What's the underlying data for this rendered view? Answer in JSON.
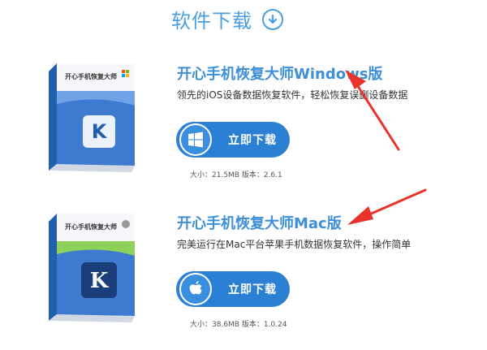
{
  "header": {
    "title": "软件下载",
    "icon": "download-circle-icon"
  },
  "products": [
    {
      "title": "开心手机恢复大师Windows版",
      "description": "领先的iOS设备数据恢复软件，轻松恢复误删设备数据",
      "button_label": "立即下载",
      "os_icon": "windows-icon",
      "box_label": "开心手机恢复大师",
      "meta": "大小：21.5MB 版本：2.6.1"
    },
    {
      "title": "开心手机恢复大师Mac版",
      "description": "完美运行在Mac平台苹果手机数据恢复软件，操作简单",
      "button_label": "立即下载",
      "os_icon": "apple-icon",
      "box_label": "开心手机恢复大师",
      "meta": "大小：38.6MB 版本：1.0.24"
    }
  ],
  "colors": {
    "accent": "#4a9fe1",
    "button": "#2c80d4",
    "arrow": "#e8322a"
  }
}
